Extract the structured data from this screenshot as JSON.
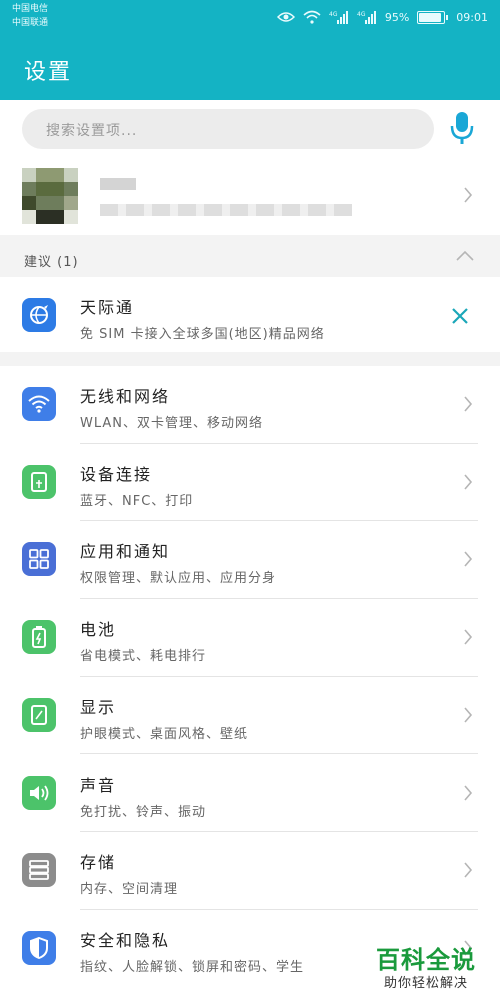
{
  "status": {
    "carrier_1": "中国电信",
    "carrier_2": "中国联通",
    "battery_percent": "95%",
    "time": "09:01"
  },
  "header": {
    "title": "设置"
  },
  "search": {
    "placeholder": "搜索设置项..."
  },
  "section": {
    "label": "建议 (1)"
  },
  "suggestion": {
    "title": "天际通",
    "subtitle": "免 SIM 卡接入全球多国(地区)精品网络"
  },
  "items": [
    {
      "title": "无线和网络",
      "subtitle": "WLAN、双卡管理、移动网络",
      "icon": "wifi-icon",
      "color": "#3f7ee8"
    },
    {
      "title": "设备连接",
      "subtitle": "蓝牙、NFC、打印",
      "icon": "device-connect-icon",
      "color": "#4cc36a"
    },
    {
      "title": "应用和通知",
      "subtitle": "权限管理、默认应用、应用分身",
      "icon": "apps-grid-icon",
      "color": "#4a6fd6"
    },
    {
      "title": "电池",
      "subtitle": "省电模式、耗电排行",
      "icon": "battery-icon",
      "color": "#4cc36a"
    },
    {
      "title": "显示",
      "subtitle": "护眼模式、桌面风格、壁纸",
      "icon": "display-icon",
      "color": "#4cc36a"
    },
    {
      "title": "声音",
      "subtitle": "免打扰、铃声、振动",
      "icon": "sound-icon",
      "color": "#4cc36a"
    },
    {
      "title": "存储",
      "subtitle": "内存、空间清理",
      "icon": "storage-icon",
      "color": "#8c8c8c"
    },
    {
      "title": "安全和隐私",
      "subtitle": "指纹、人脸解锁、锁屏和密码、学生",
      "icon": "shield-icon",
      "color": "#3f7ee8"
    }
  ],
  "watermark": {
    "brand": "百科全说",
    "tagline": "助你轻松解决"
  }
}
